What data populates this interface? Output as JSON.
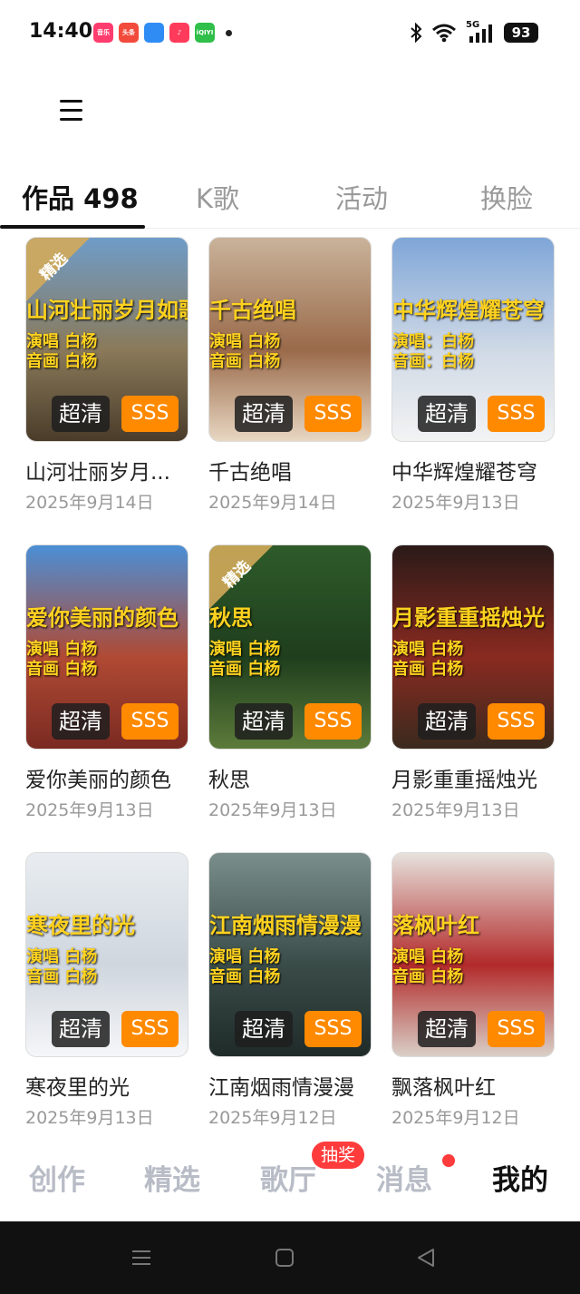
{
  "status": {
    "time": "14:40",
    "apps": [
      {
        "name": "music-app-icon",
        "color": "#ff3c6e",
        "label": "音乐"
      },
      {
        "name": "toutiao-app-icon",
        "color": "#f24b3c",
        "label": "头条"
      },
      {
        "name": "feather-app-icon",
        "color": "#2f8cf5",
        "label": ""
      },
      {
        "name": "music-note-app-icon",
        "color": "#ff3b5c",
        "label": "♪"
      },
      {
        "name": "iqiyi-app-icon",
        "color": "#2fbf4a",
        "label": "iQIYI"
      }
    ],
    "network": "5G",
    "battery": "93"
  },
  "tabs": [
    {
      "label": "作品 498",
      "active": true
    },
    {
      "label": "K歌",
      "active": false
    },
    {
      "label": "活动",
      "active": false
    },
    {
      "label": "换脸",
      "active": false
    }
  ],
  "works": [
    {
      "title": "山河壮丽岁月...",
      "date": "2025年9月14日",
      "thumb_title": "山河壮丽岁月如歌",
      "thumb_lines": [
        "演唱 白杨",
        "音画 白杨"
      ],
      "quality": "超清",
      "grade": "SSS",
      "featured": true,
      "featured_label": "精选",
      "bg": [
        "#6f9cc8",
        "#8a7a5a",
        "#4a3c2a"
      ]
    },
    {
      "title": "千古绝唱",
      "date": "2025年9月14日",
      "thumb_title": "千古绝唱",
      "thumb_lines": [
        "演唱 白杨",
        "音画 白杨"
      ],
      "quality": "超清",
      "grade": "SSS",
      "featured": false,
      "bg": [
        "#c9b39a",
        "#9a6a4a",
        "#e8d7c2"
      ]
    },
    {
      "title": "中华辉煌耀苍穹",
      "date": "2025年9月13日",
      "thumb_title": "中华辉煌耀苍穹",
      "thumb_lines": [
        "演唱：白杨",
        "音画：白杨"
      ],
      "quality": "超清",
      "grade": "SSS",
      "featured": false,
      "bg": [
        "#7fa6d8",
        "#cfd9e6",
        "#f3f3f3"
      ]
    },
    {
      "title": "爱你美丽的颜色",
      "date": "2025年9月13日",
      "thumb_title": "爱你美丽的颜色",
      "thumb_lines": [
        "演唱 白杨",
        "音画 白杨"
      ],
      "quality": "超清",
      "grade": "SSS",
      "featured": false,
      "bg": [
        "#4b8fd6",
        "#b04a34",
        "#7a2a22"
      ]
    },
    {
      "title": "秋思",
      "date": "2025年9月13日",
      "thumb_title": "秋思",
      "thumb_lines": [
        "演唱 白杨",
        "音画 白杨"
      ],
      "quality": "超清",
      "grade": "SSS",
      "featured": true,
      "featured_label": "精选",
      "bg": [
        "#2e5b2a",
        "#1f3e1d",
        "#5c7b3a"
      ]
    },
    {
      "title": "月影重重摇烛光",
      "date": "2025年9月13日",
      "thumb_title": "月影重重摇烛光",
      "thumb_lines": [
        "演唱 白杨",
        "音画 白杨"
      ],
      "quality": "超清",
      "grade": "SSS",
      "featured": false,
      "bg": [
        "#2a1a18",
        "#8a2a20",
        "#3a2a1e"
      ]
    },
    {
      "title": "寒夜里的光",
      "date": "2025年9月13日",
      "thumb_title": "寒夜里的光",
      "thumb_lines": [
        "演唱 白杨",
        "音画 白杨"
      ],
      "quality": "超清",
      "grade": "SSS",
      "featured": false,
      "bg": [
        "#e9edf1",
        "#cfd6de",
        "#f5f6f8"
      ]
    },
    {
      "title": "江南烟雨情漫漫",
      "date": "2025年9月12日",
      "thumb_title": "江南烟雨情漫漫",
      "thumb_lines": [
        "演唱 白杨",
        "音画 白杨"
      ],
      "quality": "超清",
      "grade": "SSS",
      "featured": false,
      "bg": [
        "#7a8e8c",
        "#3a4c48",
        "#1f2b29"
      ]
    },
    {
      "title": "飘落枫叶红",
      "date": "2025年9月12日",
      "thumb_title": "落枫叶红",
      "thumb_lines": [
        "演唱 白杨",
        "音画 白杨"
      ],
      "quality": "超清",
      "grade": "SSS",
      "featured": false,
      "bg": [
        "#e7e2dd",
        "#b22a2a",
        "#d9cfc7"
      ]
    }
  ],
  "bottom_nav": [
    {
      "label": "创作",
      "active": false
    },
    {
      "label": "精选",
      "active": false
    },
    {
      "label": "歌厅",
      "active": false
    },
    {
      "label": "消息",
      "active": false
    },
    {
      "label": "我的",
      "active": true
    }
  ],
  "nav_badge": "抽奖"
}
